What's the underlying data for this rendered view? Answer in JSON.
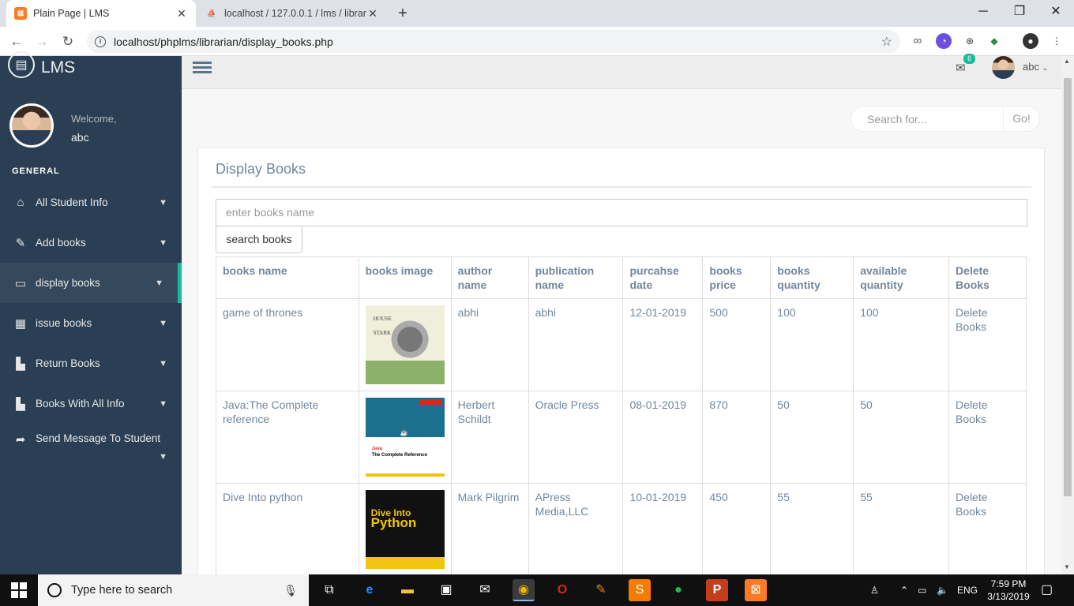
{
  "browser": {
    "tabs": [
      {
        "title": "Plain Page | LMS",
        "active": true,
        "icon": "xampp-icon"
      },
      {
        "title": "localhost / 127.0.0.1 / lms / librar",
        "active": false,
        "icon": "phpmyadmin-icon"
      }
    ],
    "url": "localhost/phplms/librarian/display_books.php"
  },
  "sidebar": {
    "brand": "LMS",
    "welcome": "Welcome,",
    "username": "abc",
    "section": "GENERAL",
    "items": [
      {
        "label": "All Student Info",
        "icon": "home-icon"
      },
      {
        "label": "Add books",
        "icon": "edit-icon"
      },
      {
        "label": "display books",
        "icon": "desktop-icon",
        "active": true
      },
      {
        "label": "issue books",
        "icon": "table-icon"
      },
      {
        "label": "Return Books",
        "icon": "bar-chart-icon"
      },
      {
        "label": "Books With All Info",
        "icon": "bar-chart-icon"
      },
      {
        "label": "Send Message To Student",
        "icon": "share-icon"
      }
    ]
  },
  "topnav": {
    "mail_count": "6",
    "user": "abc"
  },
  "search": {
    "placeholder": "Search for...",
    "go": "Go!"
  },
  "panel": {
    "title": "Display Books",
    "input_placeholder": "enter books name",
    "button": "search books",
    "columns": [
      "books name",
      "books image",
      "author name",
      "publication name",
      "purcahse date",
      "books price",
      "books quantity",
      "available quantity",
      "Delete Books"
    ],
    "rows": [
      {
        "name": "game of thrones",
        "image": "house-stark-cover",
        "author": "abhi",
        "publication": "abhi",
        "date": "12-01-2019",
        "price": "500",
        "quantity": "100",
        "available": "100",
        "delete": "Delete Books"
      },
      {
        "name": "Java:The Complete reference",
        "image": "java-cover",
        "author": "Herbert Schildt",
        "publication": "Oracle Press",
        "date": "08-01-2019",
        "price": "870",
        "quantity": "50",
        "available": "50",
        "delete": "Delete Books"
      },
      {
        "name": "Dive Into python",
        "image": "python-cover",
        "author": "Mark Pilgrim",
        "publication": "APress Media,LLC",
        "date": "10-01-2019",
        "price": "450",
        "quantity": "55",
        "available": "55",
        "delete": "Delete Books"
      }
    ],
    "cover_text": {
      "got_line1": "HOUSE",
      "got_line2": "STARK",
      "java_title": "Java",
      "java_sub": "The Complete Reference",
      "python_line1": "Dive Into",
      "python_line2": "Python"
    }
  },
  "taskbar": {
    "search_placeholder": "Type here to search",
    "lang": "ENG",
    "time": "7:59 PM",
    "date": "3/13/2019"
  },
  "colors": {
    "sidebar_bg": "#2A3F54",
    "accent": "#1ABB9C",
    "text": "#73879C"
  }
}
